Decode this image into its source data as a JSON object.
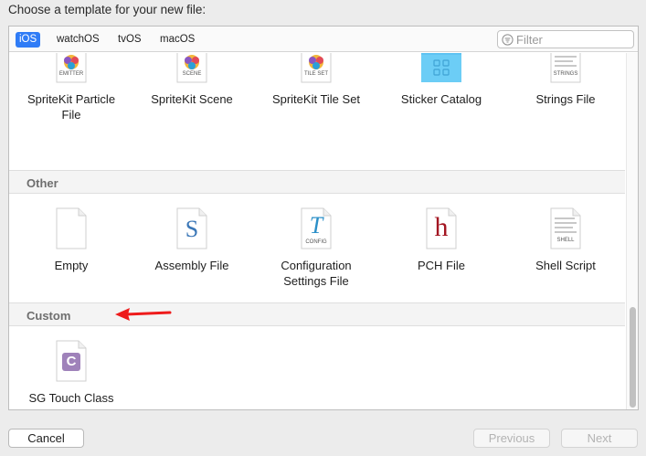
{
  "dialog": {
    "title": "Choose a template for your new file:"
  },
  "tabs": [
    {
      "label": "iOS",
      "active": true
    },
    {
      "label": "watchOS",
      "active": false
    },
    {
      "label": "tvOS",
      "active": false
    },
    {
      "label": "macOS",
      "active": false
    }
  ],
  "filter": {
    "placeholder": "Filter",
    "value": ""
  },
  "row1": [
    {
      "label": "SpriteKit Particle\nFile",
      "badge": "EMITTER",
      "icon": "spritekit-emitter-icon"
    },
    {
      "label": "SpriteKit Scene",
      "badge": "SCENE",
      "icon": "spritekit-scene-icon"
    },
    {
      "label": "SpriteKit Tile Set",
      "badge": "TILE SET",
      "icon": "spritekit-tileset-icon"
    },
    {
      "label": "Sticker Catalog",
      "icon": "folder-icon"
    },
    {
      "label": "Strings File",
      "badge": "STRINGS",
      "icon": "strings-file-icon"
    }
  ],
  "sections": {
    "other": "Other",
    "custom": "Custom"
  },
  "other": [
    {
      "label": "Empty",
      "icon": "empty-file-icon"
    },
    {
      "label": "Assembly File",
      "glyph": "S",
      "icon": "assembly-file-icon"
    },
    {
      "label": "Configuration\nSettings File",
      "glyph": "T",
      "badge": "CONFIG",
      "icon": "config-file-icon"
    },
    {
      "label": "PCH File",
      "glyph": "h",
      "icon": "pch-file-icon"
    },
    {
      "label": "Shell Script",
      "badge": "SHELL",
      "icon": "shell-script-icon"
    }
  ],
  "custom": [
    {
      "label": "SG Touch Class",
      "glyph": "C",
      "icon": "c-class-file-icon"
    }
  ],
  "buttons": {
    "cancel": "Cancel",
    "previous": "Previous",
    "next": "Next"
  },
  "colors": {
    "accent": "#2f7cf6",
    "arrow": "#ee1b1b",
    "folder": "#5ec3f2",
    "pch": "#a31622",
    "assembly": "#3b77b7",
    "config": "#2b8fc8",
    "custom_class": "#9f82ba"
  }
}
